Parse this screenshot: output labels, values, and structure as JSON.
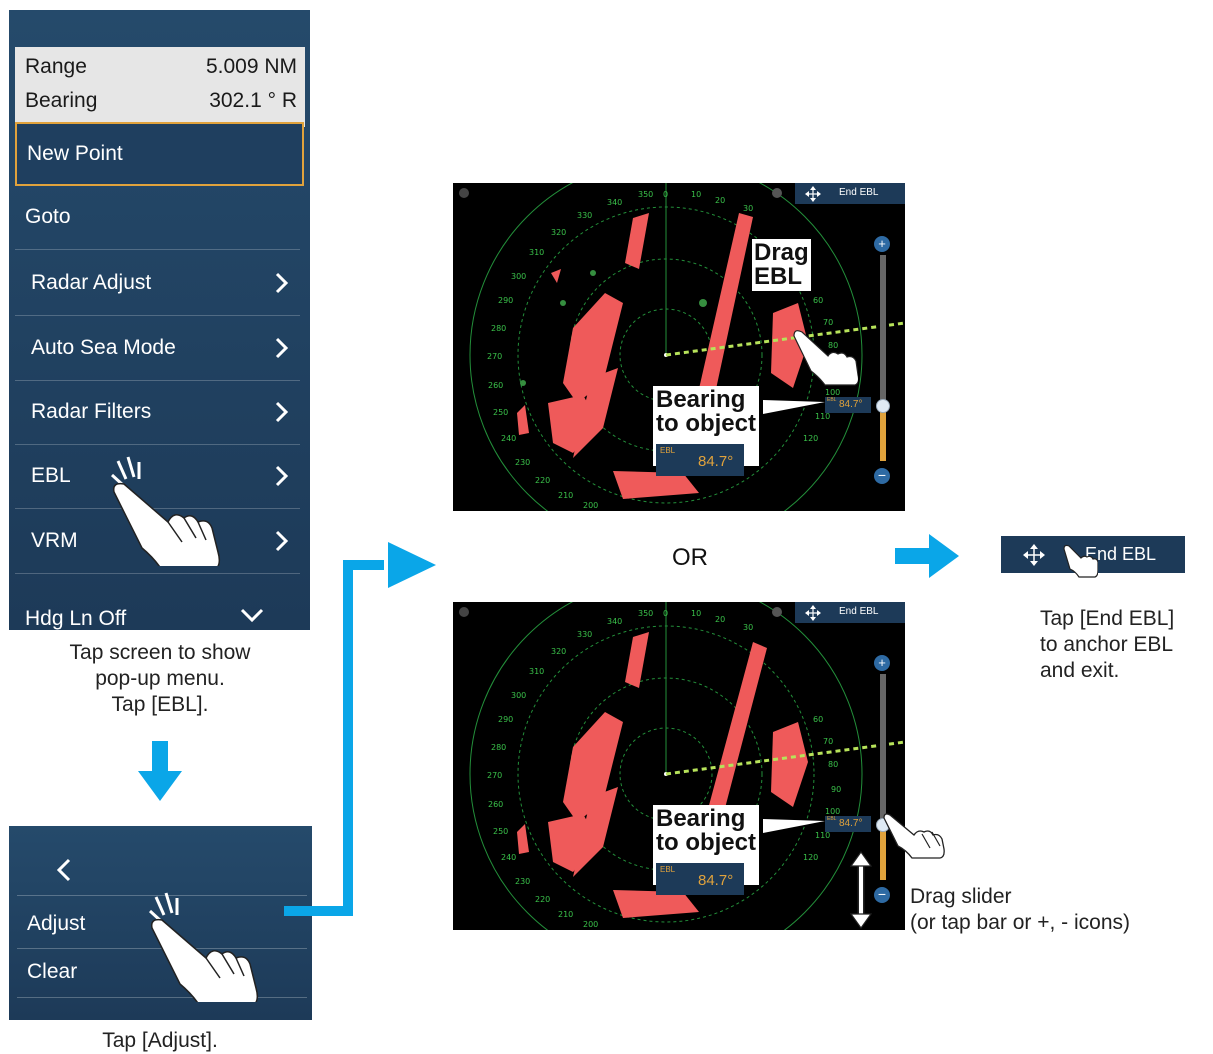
{
  "menu": {
    "range_label": "Range",
    "range_value": "5.009 NM",
    "bearing_label": "Bearing",
    "bearing_value": "302.1 ° R",
    "items": [
      {
        "label": "New Point"
      },
      {
        "label": "Goto"
      },
      {
        "label": "Radar Adjust"
      },
      {
        "label": "Auto Sea Mode"
      },
      {
        "label": "Radar Filters"
      },
      {
        "label": "EBL"
      },
      {
        "label": "VRM"
      },
      {
        "label": "Hdg Ln Off"
      }
    ]
  },
  "captions": {
    "step1": [
      "Tap screen to show",
      "pop-up menu.",
      "Tap [EBL]."
    ],
    "step2": "Tap [Adjust].",
    "or": "OR",
    "end": [
      "Tap [End EBL]",
      "to anchor EBL",
      "and exit."
    ],
    "slider": [
      "Drag slider",
      "(or tap bar or +, - icons)"
    ]
  },
  "submenu": {
    "back_icon": "chevron-left-icon",
    "items": [
      {
        "label": "Adjust"
      },
      {
        "label": "Clear"
      }
    ]
  },
  "radar_top": {
    "end_ebl": "End EBL",
    "callout_drag": [
      "Drag",
      "EBL"
    ],
    "callout_bearing": [
      "Bearing",
      "to object"
    ],
    "ebl_tag": "EBL",
    "ebl_value": "84.7°",
    "tick_labels": [
      "350",
      "0",
      "10",
      "20",
      "30",
      "60",
      "70",
      "80",
      "90",
      "100",
      "110",
      "120",
      "200",
      "210",
      "220",
      "230",
      "240",
      "250",
      "260",
      "270",
      "280",
      "290",
      "300",
      "310",
      "320",
      "330",
      "340"
    ]
  },
  "radar_bottom": {
    "end_ebl": "End EBL",
    "callout_bearing": [
      "Bearing",
      "to object"
    ],
    "ebl_tag": "EBL",
    "ebl_value": "84.7°",
    "tick_labels": [
      "350",
      "0",
      "10",
      "20",
      "30",
      "60",
      "70",
      "80",
      "90",
      "100",
      "110",
      "120",
      "200",
      "210",
      "220",
      "230",
      "240",
      "250",
      "260",
      "270",
      "280",
      "290",
      "300",
      "310",
      "320",
      "330",
      "340"
    ]
  },
  "end_button": {
    "label": "End EBL"
  },
  "colors": {
    "menu_bg": "#1d3a58",
    "accent": "#e0a23c",
    "arrow": "#0aa6e8",
    "echo": "#ef5a5a",
    "ring": "#2bb94a"
  }
}
